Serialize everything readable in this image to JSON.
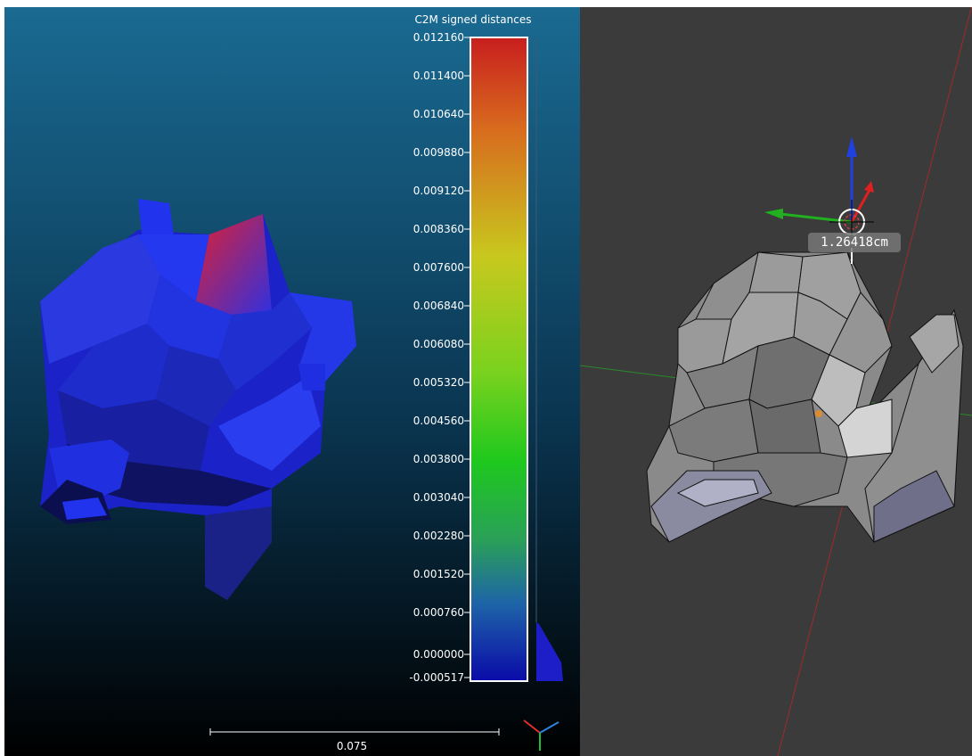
{
  "colors": {
    "viewport_bg_top": "#1a6a92",
    "viewport_bg_bottom": "#000000",
    "blender_bg": "#3b3b3b",
    "model_blue": "#2233ee",
    "peak_red": "#e02030",
    "axis_red": "#a02020",
    "axis_green": "#20a020",
    "gizmo_blue": "#2040e0"
  },
  "left_panel": {
    "scalar_field": {
      "title": "C2M signed distances",
      "ticks": [
        "0.012160",
        "0.011400",
        "0.010640",
        "0.009880",
        "0.009120",
        "0.008360",
        "0.007600",
        "0.006840",
        "0.006080",
        "0.005320",
        "0.004560",
        "0.003800",
        "0.003040",
        "0.002280",
        "0.001520",
        "0.000760",
        "0.000000",
        "-0.000517"
      ],
      "gradient_stops": [
        "#c81e1e",
        "#d86a1e",
        "#c8c81e",
        "#7ad21e",
        "#1ec81e",
        "#2aa058",
        "#1e64a8",
        "#0a0aa8"
      ]
    },
    "scale_bar_value": "0.075",
    "axis_triad_icon": "axis-triad-icon"
  },
  "right_panel": {
    "measurement_value": "1.26418cm",
    "gizmo_icon": "transform-gizmo-icon",
    "origin_icon": "object-origin-icon"
  }
}
